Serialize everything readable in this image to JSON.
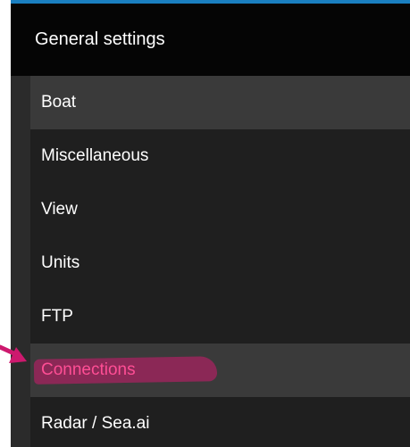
{
  "header": {
    "title": "General settings"
  },
  "menu": {
    "items": [
      {
        "label": "Boat"
      },
      {
        "label": "Miscellaneous"
      },
      {
        "label": "View"
      },
      {
        "label": "Units"
      },
      {
        "label": "FTP"
      },
      {
        "label": "Connections"
      },
      {
        "label": "Radar / Sea.ai"
      }
    ]
  },
  "colors": {
    "accent_top": "#1a7fc1",
    "annotation": "#cd196e",
    "highlight_text": "#ff4e95"
  }
}
